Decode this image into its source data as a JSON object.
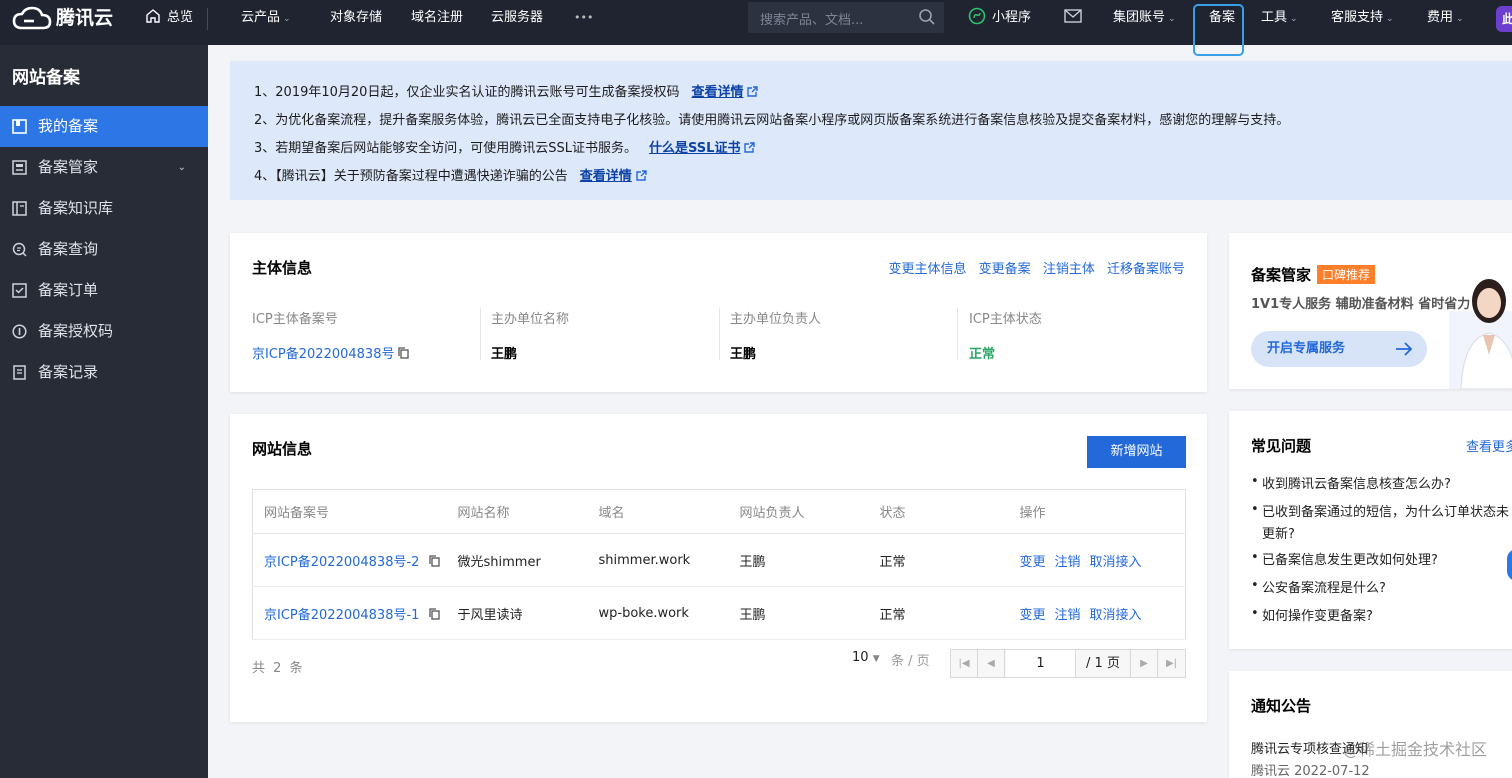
{
  "topbar": {
    "logo_text": "腾讯云",
    "home": "总览",
    "products": "云产品",
    "nav": [
      "对象存储",
      "域名注册",
      "云服务器"
    ],
    "more": "•••",
    "search_placeholder": "搜索产品、文档...",
    "miniprogram": "小程序",
    "group_account": "集团账号",
    "beian": "备案",
    "tools": "工具",
    "support": "客服支持",
    "fees": "费用",
    "avatar_text": "此"
  },
  "sidebar": {
    "title": "网站备案",
    "items": [
      {
        "label": "我的备案",
        "icon": "my-beian-icon"
      },
      {
        "label": "备案管家",
        "icon": "butler-icon"
      },
      {
        "label": "备案知识库",
        "icon": "knowledge-icon"
      },
      {
        "label": "备案查询",
        "icon": "query-icon"
      },
      {
        "label": "备案订单",
        "icon": "order-icon"
      },
      {
        "label": "备案授权码",
        "icon": "auth-code-icon"
      },
      {
        "label": "备案记录",
        "icon": "record-icon"
      }
    ]
  },
  "notice": {
    "lines": [
      {
        "text": "1、2019年10月20日起，仅企业实名认证的腾讯云账号可生成备案授权码",
        "link": "查看详情"
      },
      {
        "text": "2、为优化备案流程，提升备案服务体验，腾讯云已全面支持电子化核验。请使用腾讯云网站备案小程序或网页版备案系统进行备案信息核验及提交备案材料，感谢您的理解与支持。",
        "link": ""
      },
      {
        "text": "3、若期望备案后网站能够安全访问，可使用腾讯云SSL证书服务。",
        "link": "什么是SSL证书"
      },
      {
        "text": "4、【腾讯云】关于预防备案过程中遭遇快递诈骗的公告",
        "link": "查看详情"
      }
    ]
  },
  "subject": {
    "title": "主体信息",
    "actions": [
      "变更主体信息",
      "变更备案",
      "注销主体",
      "迁移备案账号"
    ],
    "fields": [
      {
        "label": "ICP主体备案号",
        "value": "京ICP备2022004838号"
      },
      {
        "label": "主办单位名称",
        "value": "王鹏"
      },
      {
        "label": "主办单位负责人",
        "value": "王鹏"
      },
      {
        "label": "ICP主体状态",
        "value": "正常"
      }
    ]
  },
  "sites": {
    "title": "网站信息",
    "add_button": "新增网站",
    "columns": [
      "网站备案号",
      "网站名称",
      "域名",
      "网站负责人",
      "状态",
      "操作"
    ],
    "rows": [
      {
        "icp": "京ICP备2022004838号-2",
        "name": "微光shimmer",
        "domain": "shimmer.work",
        "owner": "王鹏",
        "status": "正常",
        "ops": [
          "变更",
          "注销",
          "取消接入"
        ]
      },
      {
        "icp": "京ICP备2022004838号-1",
        "name": "于风里读诗",
        "domain": "wp-boke.work",
        "owner": "王鹏",
        "status": "正常",
        "ops": [
          "变更",
          "注销",
          "取消接入"
        ]
      }
    ],
    "total": "共 2 条",
    "page_size": "10",
    "page_size_unit": "条 / 页",
    "current_page": "1",
    "total_pages": "/ 1 页"
  },
  "butler": {
    "title": "备案管家",
    "badge": "口碑推荐",
    "desc": "1V1专人服务 辅助准备材料 省时省力",
    "button": "开启专属服务"
  },
  "faq": {
    "title": "常见问题",
    "more": "查看更多",
    "items": [
      "收到腾讯云备案信息核查怎么办?",
      "已收到备案通过的短信，为什么订单状态未",
      "更新?",
      "已备案信息发生更改如何处理?",
      "公安备案流程是什么?",
      "如何操作变更备案?"
    ]
  },
  "announce": {
    "title": "通知公告",
    "item_title": "腾讯云专项核查通知",
    "item_date": "腾讯云 2022-07-12",
    "watermark": "@稀土掘金技术社区"
  },
  "colors": {
    "primary": "#2469d9",
    "topbar": "#1f2430",
    "sidebar": "#272c36",
    "active": "#2d76e6",
    "ok": "#29a564",
    "badge": "#ff7e2a"
  }
}
